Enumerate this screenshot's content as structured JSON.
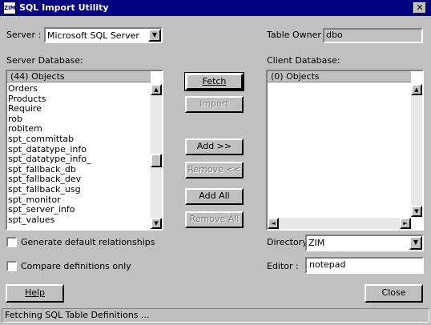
{
  "window": {
    "title": "SQL Import Utility",
    "close_glyph": "✕",
    "icon_text": "ZIM"
  },
  "server": {
    "label": "Server :",
    "value": "Microsoft SQL Server"
  },
  "table_owner": {
    "label": "Table Owner :",
    "value": "dbo"
  },
  "server_db": {
    "label": "Server Database:",
    "header": "(44) Objects",
    "items": [
      "Orders",
      "Products",
      "Require",
      "rob",
      "robitem",
      "spt_committab",
      "spt_datatype_info",
      "spt_datatype_info_",
      "spt_fallback_db",
      "spt_fallback_dev",
      "spt_fallback_usg",
      "spt_monitor",
      "spt_server_info",
      "spt_values"
    ]
  },
  "client_db": {
    "label": "Client Database:",
    "header": "(0) Objects"
  },
  "buttons": {
    "fetch": "Fetch",
    "import": "Import",
    "add": "Add >>",
    "remove": "Remove <<",
    "add_all": "Add All",
    "remove_all": "Remove All",
    "help": "Help",
    "close": "Close"
  },
  "options": {
    "generate_relationships": "Generate default relationships",
    "compare_only": "Compare definitions only"
  },
  "directory": {
    "label": "Directory :",
    "value": "ZIM"
  },
  "editor": {
    "label": "Editor :",
    "value": "notepad"
  },
  "status": "Fetching SQL Table Definitions ..."
}
